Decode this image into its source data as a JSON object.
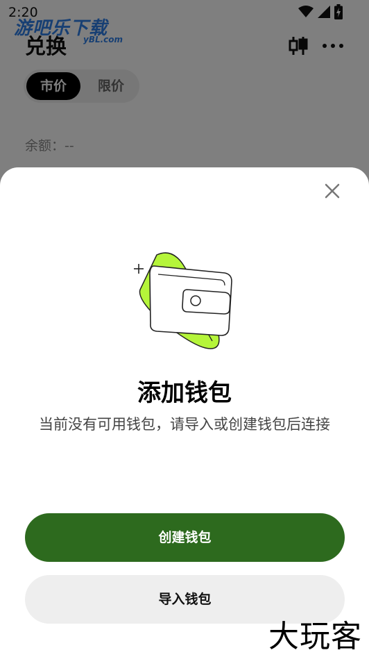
{
  "status": {
    "time": "2:20"
  },
  "watermark_top": {
    "main": "游吧乐下载",
    "sub": "yBL.com"
  },
  "header": {
    "title": "兑换"
  },
  "tabs": [
    {
      "label": "市价"
    },
    {
      "label": "限价"
    }
  ],
  "balance": {
    "label": "余额：--"
  },
  "sheet": {
    "title": "添加钱包",
    "description": "当前没有可用钱包，请导入或创建钱包后连接",
    "create_label": "创建钱包",
    "import_label": "导入钱包"
  },
  "colors": {
    "accent_green": "#2d6a1e",
    "lime": "#b5f53a"
  },
  "icons": [
    "wifi-icon",
    "signal-icon",
    "battery-icon",
    "candlestick-icon",
    "more-icon",
    "close-icon",
    "wallet-illustration"
  ],
  "watermark_bottom": {
    "text": "大玩客"
  }
}
